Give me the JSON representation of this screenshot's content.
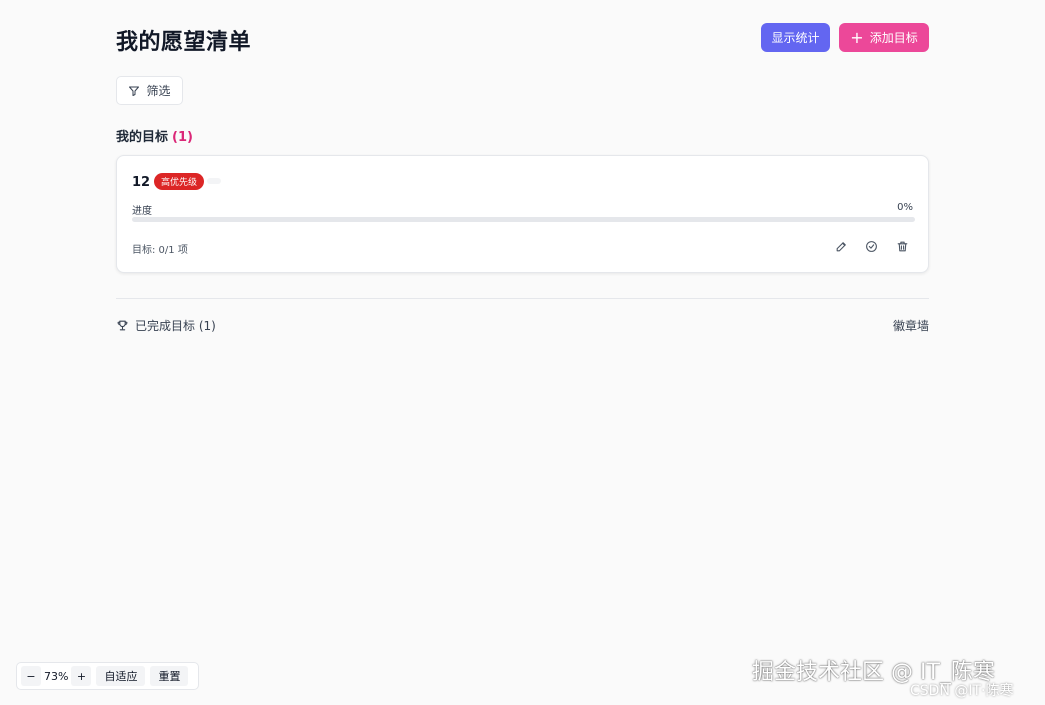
{
  "header": {
    "title": "我的愿望清单",
    "stats_button": "显示统计",
    "add_button": "添加目标",
    "add_icon": "+"
  },
  "filter": {
    "label": "筛选",
    "icon": "filter-icon"
  },
  "my_goals": {
    "title": "我的目标",
    "count": "(1)"
  },
  "goal_card": {
    "name": "12",
    "priority": "高优先级",
    "progress_label": "进度",
    "progress_text": "0%",
    "progress_fraction": 0,
    "items": "目标: 0/1 项",
    "actions": [
      "edit-icon",
      "complete-icon",
      "delete-icon"
    ]
  },
  "completed": {
    "label": "已完成目标 (1)",
    "icon": "trophy-icon",
    "badge_wall": "徽章墙"
  },
  "zoom": {
    "minus": "−",
    "level": "73%",
    "plus": "+",
    "fit": "自适应",
    "reset": "重置"
  },
  "watermark": {
    "main": "掘金技术社区 @ IT_陈寒",
    "sub": "CSDN @IT·陈寒"
  },
  "colors": {
    "stats_button": "#6366f1",
    "add_button": "#ec4899",
    "priority_high": "#dc2626",
    "count_accent": "#db2777"
  }
}
